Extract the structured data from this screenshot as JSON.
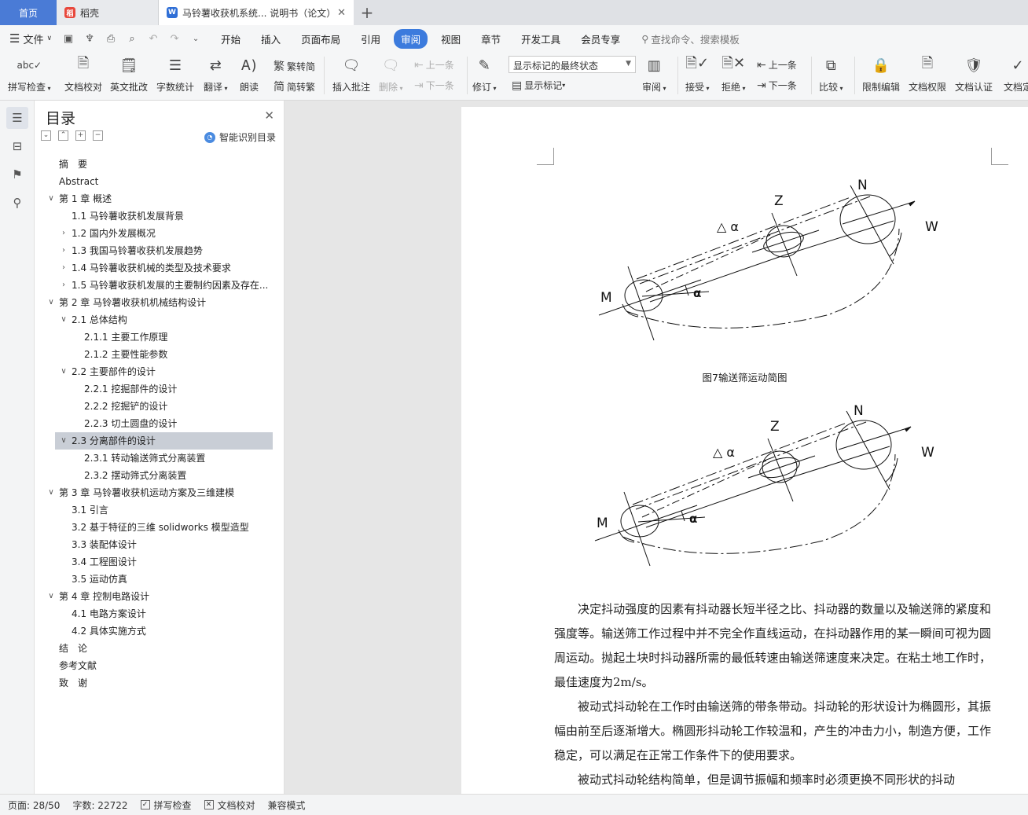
{
  "tabs": {
    "home": "首页",
    "daoke": "稻壳",
    "doc": "马铃薯收获机系统... 说明书（论文）"
  },
  "menu": {
    "file": "文件",
    "tabs": [
      "开始",
      "插入",
      "页面布局",
      "引用",
      "审阅",
      "视图",
      "章节",
      "开发工具",
      "会员专享"
    ],
    "active_tab": "审阅",
    "search_placeholder": "查找命令、搜索模板"
  },
  "ribbon": {
    "spell": "拼写检查",
    "proof": "文档校对",
    "english": "英文批改",
    "wordcount": "字数统计",
    "translate": "翻译",
    "read": "朗读",
    "to_trad": "繁转简",
    "to_simp": "简转繁",
    "insert_comment": "插入批注",
    "delete": "删除",
    "prev": "上一条",
    "next": "下一条",
    "revise": "修订",
    "mark_state": "显示标记的最终状态",
    "show_mark": "显示标记",
    "review": "审阅",
    "accept": "接受",
    "reject": "拒绝",
    "prev2": "上一条",
    "next2": "下一条",
    "compare": "比较",
    "restrict": "限制编辑",
    "doc_perm": "文档权限",
    "doc_cert": "文档认证",
    "doc_final": "文档定"
  },
  "toc": {
    "title": "目录",
    "smart": "智能识别目录",
    "items": [
      {
        "label": "摘　要",
        "level": 1,
        "chev": ""
      },
      {
        "label": "Abstract",
        "level": 1,
        "chev": ""
      },
      {
        "label": "第 1 章  概述",
        "level": 1,
        "chev": "down"
      },
      {
        "label": "1.1 马铃薯收获机发展背景",
        "level": 2,
        "chev": ""
      },
      {
        "label": "1.2 国内外发展概况",
        "level": 2,
        "chev": "right"
      },
      {
        "label": "1.3 我国马铃薯收获机发展趋势",
        "level": 2,
        "chev": "right"
      },
      {
        "label": "1.4 马铃薯收获机械的类型及技术要求",
        "level": 2,
        "chev": "right"
      },
      {
        "label": "1.5 马铃薯收获机发展的主要制约因素及存在...",
        "level": 2,
        "chev": "right"
      },
      {
        "label": "第 2 章  马铃薯收获机机械结构设计",
        "level": 1,
        "chev": "down"
      },
      {
        "label": "2.1 总体结构",
        "level": 2,
        "chev": "down"
      },
      {
        "label": "2.1.1 主要工作原理",
        "level": 3,
        "chev": ""
      },
      {
        "label": "2.1.2 主要性能参数",
        "level": 3,
        "chev": ""
      },
      {
        "label": "2.2 主要部件的设计",
        "level": 2,
        "chev": "down"
      },
      {
        "label": "2.2.1 挖掘部件的设计",
        "level": 3,
        "chev": ""
      },
      {
        "label": "2.2.2 挖掘铲的设计",
        "level": 3,
        "chev": ""
      },
      {
        "label": "2.2.3 切土圆盘的设计",
        "level": 3,
        "chev": ""
      },
      {
        "label": "2.3 分离部件的设计",
        "level": 2,
        "chev": "down",
        "selected": true
      },
      {
        "label": "2.3.1 转动输送筛式分离装置",
        "level": 3,
        "chev": ""
      },
      {
        "label": "2.3.2 摆动筛式分离装置",
        "level": 3,
        "chev": ""
      },
      {
        "label": "第 3 章  马铃薯收获机运动方案及三维建模",
        "level": 1,
        "chev": "down"
      },
      {
        "label": "3.1 引言",
        "level": 2,
        "chev": ""
      },
      {
        "label": "3.2 基于特征的三维 solidworks 模型造型",
        "level": 2,
        "chev": ""
      },
      {
        "label": "3.3 装配体设计",
        "level": 2,
        "chev": ""
      },
      {
        "label": "3.4 工程图设计",
        "level": 2,
        "chev": ""
      },
      {
        "label": "3.5 运动仿真",
        "level": 2,
        "chev": ""
      },
      {
        "label": "第 4 章  控制电路设计",
        "level": 1,
        "chev": "down"
      },
      {
        "label": "4.1 电路方案设计",
        "level": 2,
        "chev": ""
      },
      {
        "label": "4.2 具体实施方式",
        "level": 2,
        "chev": ""
      },
      {
        "label": "结　论",
        "level": 1,
        "chev": ""
      },
      {
        "label": "参考文献",
        "level": 1,
        "chev": ""
      },
      {
        "label": "致　谢",
        "level": 1,
        "chev": ""
      }
    ]
  },
  "document": {
    "figure_labels": {
      "m": "M",
      "z": "Z",
      "n": "N",
      "w": "W",
      "delta": "△ α",
      "alpha": "α"
    },
    "caption1": "图7输送筛运动简图",
    "para1": "　　决定抖动强度的因素有抖动器长短半径之比、抖动器的数量以及输送筛的紧度和强度等。输送筛工作过程中并不完全作直线运动，在抖动器作用的某一瞬间可视为圆周运动。抛起土块时抖动器所需的最低转速由输送筛速度来决定。在粘土地工作时，最佳速度为2m/s。",
    "para2": "　　被动式抖动轮在工作时由输送筛的带条带动。抖动轮的形状设计为椭圆形，其振幅由前至后逐渐增大。椭圆形抖动轮工作较温和，产生的冲击力小，制造方便，工作稳定，可以满足在正常工作条件下的使用要求。",
    "para3": "　　被动式抖动轮结构简单，但是调节振幅和频率时必须更换不同形状的抖动"
  },
  "status": {
    "page": "页面: 28/50",
    "words": "字数: 22722",
    "spell": "拼写检查",
    "proof": "文档校对",
    "compat": "兼容模式"
  }
}
